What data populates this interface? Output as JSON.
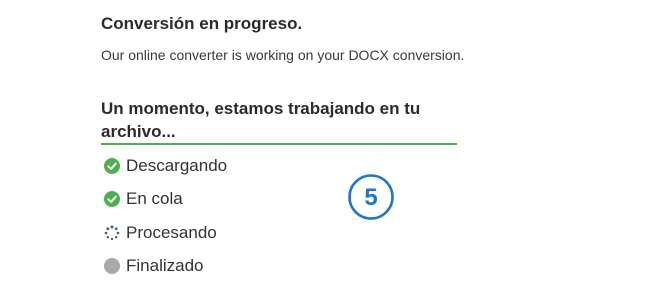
{
  "status": {
    "title": "Conversión en progreso.",
    "subtitle": "Our online converter is working on your DOCX conversion."
  },
  "progress": {
    "heading": "Un momento, estamos trabajando en tu archivo...",
    "steps": [
      {
        "label": "Descargando",
        "state": "done",
        "icon": "check-circle-icon"
      },
      {
        "label": "En cola",
        "state": "done",
        "icon": "check-circle-icon"
      },
      {
        "label": "Procesando",
        "state": "in-progress",
        "icon": "spinner-icon"
      },
      {
        "label": "Finalizado",
        "state": "pending",
        "icon": "pending-circle-icon"
      }
    ],
    "step_marker": "5"
  },
  "colors": {
    "accent_green": "#4caf50",
    "pending_gray": "#a8a8a8",
    "marker_blue": "#1e78c8"
  }
}
